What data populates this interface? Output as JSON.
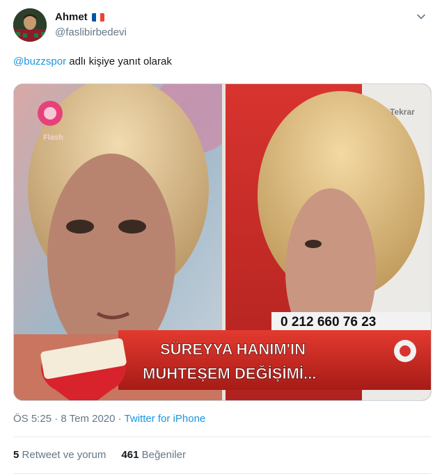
{
  "tweet": {
    "author": {
      "display_name": "Ahmet",
      "handle": "@faslibirbedevi",
      "flag": "french-flag-emoji"
    },
    "reply_context": {
      "mention": "@buzzspor",
      "text": " adlı kişiye yanıt olarak"
    },
    "media": {
      "channel_logo": "Flash",
      "replay_badge": "Tekrar",
      "phone": "0 212 660 76 23",
      "headline_line1": "SÜREYYA HANIM'IN",
      "headline_line2": "MUHTEŞEM DEĞİŞİMİ..."
    },
    "timestamp": "ÖS 5:25 · 8 Tem 2020 · ",
    "source": "Twitter for iPhone",
    "stats": {
      "retweets_count": "5",
      "retweets_label": "Retweet ve yorum",
      "likes_count": "461",
      "likes_label": "Beğeniler"
    }
  },
  "colors": {
    "link": "#1b95e0",
    "muted": "#657786",
    "text": "#14171a",
    "divider": "#e6ecf0"
  }
}
